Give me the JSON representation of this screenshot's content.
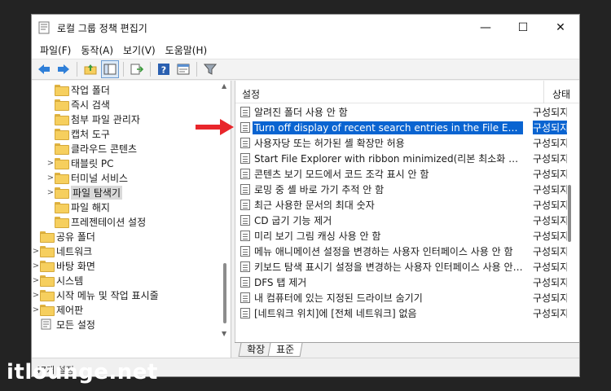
{
  "window": {
    "title": "로컬 그룹 정책 편집기",
    "controls": {
      "minimize": "—",
      "maximize": "☐",
      "close": "✕"
    }
  },
  "menu": [
    "파일(F)",
    "동작(A)",
    "보기(V)",
    "도움말(H)"
  ],
  "toolbar": {
    "icons": [
      "back-arrow-icon",
      "forward-arrow-icon",
      "folder-up-icon",
      "show-hide-tree-icon",
      "export-list-icon",
      "help-icon",
      "properties-icon",
      "filter-icon"
    ]
  },
  "tree": {
    "items": [
      {
        "label": "작업 폴더",
        "level": 2,
        "expander": ""
      },
      {
        "label": "즉시 검색",
        "level": 2,
        "expander": ""
      },
      {
        "label": "첨부 파일 관리자",
        "level": 2,
        "expander": ""
      },
      {
        "label": "캡처 도구",
        "level": 2,
        "expander": ""
      },
      {
        "label": "클라우드 콘텐츠",
        "level": 2,
        "expander": ""
      },
      {
        "label": "태블릿 PC",
        "level": 2,
        "expander": ">"
      },
      {
        "label": "터미널 서비스",
        "level": 2,
        "expander": ">"
      },
      {
        "label": "파일 탐색기",
        "level": 2,
        "expander": ">",
        "selected": true
      },
      {
        "label": "파일 해지",
        "level": 2,
        "expander": ""
      },
      {
        "label": "프레젠테이션 설정",
        "level": 2,
        "expander": ""
      },
      {
        "label": "공유 폴더",
        "level": 1,
        "expander": ""
      },
      {
        "label": "네트워크",
        "level": 1,
        "expander": ">"
      },
      {
        "label": "바탕 화면",
        "level": 1,
        "expander": ">"
      },
      {
        "label": "시스템",
        "level": 1,
        "expander": ">"
      },
      {
        "label": "시작 메뉴 및 작업 표시줄",
        "level": 1,
        "expander": ">"
      },
      {
        "label": "제어판",
        "level": 1,
        "expander": ">"
      },
      {
        "label": "모든 설정",
        "level": 1,
        "expander": "",
        "icon": "all-settings-icon"
      }
    ]
  },
  "list": {
    "columns": {
      "setting": "설정",
      "state": "상태"
    },
    "rows": [
      {
        "name": "알려진 폴더 사용 안 함",
        "state": "구성되지 않음"
      },
      {
        "name": "Turn off display of recent search entries in the File Explorer search box",
        "state": "구성되지 않음",
        "selected": true
      },
      {
        "name": "사용자당 또는 허가된 셸 확장만 허용",
        "state": "구성되지 않음"
      },
      {
        "name": "Start File Explorer with ribbon minimized(리본 최소화 상태로 시작)",
        "state": "구성되지 않음"
      },
      {
        "name": "콘텐츠 보기 모드에서 코드 조각 표시 안 함",
        "state": "구성되지 않음"
      },
      {
        "name": "로밍 중 셸 바로 가기 추적 안 함",
        "state": "구성되지 않음"
      },
      {
        "name": "최근 사용한 문서의 최대 숫자",
        "state": "구성되지 않음"
      },
      {
        "name": "CD 굽기 기능 제거",
        "state": "구성되지 않음"
      },
      {
        "name": "미리 보기 그림 캐싱 사용 안 함",
        "state": "구성되지 않음"
      },
      {
        "name": "메뉴 애니메이션 설정을 변경하는 사용자 인터페이스 사용 안 함",
        "state": "구성되지 않음"
      },
      {
        "name": "키보드 탐색 표시기 설정을 변경하는 사용자 인터페이스 사용 안 함",
        "state": "구성되지 않음"
      },
      {
        "name": "DFS 탭 제거",
        "state": "구성되지 않음"
      },
      {
        "name": "내 컴퓨터에 있는 지정된 드라이브 숨기기",
        "state": "구성되지 않음"
      },
      {
        "name": "[네트워크 위치]에 [전체 네트워크] 없음",
        "state": "구성되지 않음"
      }
    ]
  },
  "tabs": [
    "확장",
    "표준"
  ],
  "status": "47개 설정",
  "watermark": "itlounge.net",
  "colors": {
    "selection": "#0a64d1",
    "arrow": "#e8262b",
    "background": "#232323"
  }
}
